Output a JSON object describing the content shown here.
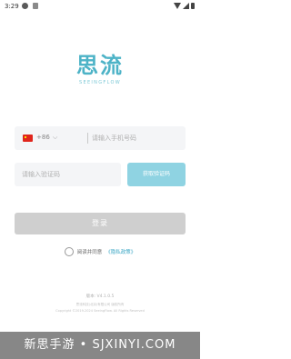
{
  "status": {
    "time": "3:29"
  },
  "brand": {
    "name_cn": "思流",
    "name_en": "SEEINGFLOW",
    "color": "#4db3c7"
  },
  "phone": {
    "country_code": "+86",
    "placeholder": "请输入手机号码"
  },
  "sms": {
    "placeholder": "请输入验证码",
    "button_label": "获取验证码"
  },
  "login": {
    "label": "登录"
  },
  "agreement": {
    "text": "阅读并同意",
    "link": "《隐私政策》"
  },
  "footer": {
    "version": "版本: V4.1.0.5",
    "line1": "思流科技(北京)有限公司 版权所有",
    "line2": "Copyright ©2019-2024 SeeingFlow. All Rights Reserved"
  },
  "watermark": {
    "text": "新思手游 • SJXINYI.COM"
  },
  "colors": {
    "accent": "#4db3c7",
    "sms_button": "#8fd3e2",
    "login_disabled": "#cfcfcf",
    "link": "#3aa6c4"
  }
}
